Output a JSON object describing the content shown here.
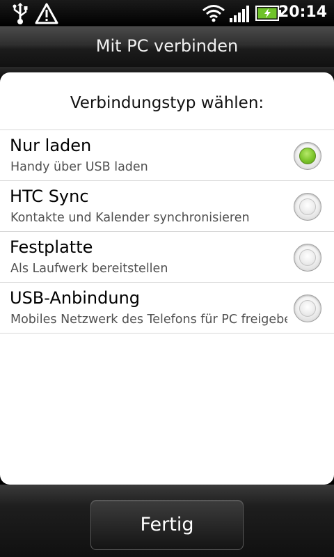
{
  "status_bar": {
    "time": "20:14",
    "icons": [
      "usb-icon",
      "warning-icon",
      "wifi-icon",
      "signal-icon",
      "battery-charging-icon"
    ]
  },
  "title": "Mit PC verbinden",
  "dialog": {
    "heading": "Verbindungstyp wählen:",
    "options": [
      {
        "title": "Nur laden",
        "subtitle": "Handy über USB laden",
        "selected": true
      },
      {
        "title": "HTC Sync",
        "subtitle": "Kontakte und Kalender synchronisieren",
        "selected": false
      },
      {
        "title": "Festplatte",
        "subtitle": "Als Laufwerk bereitstellen",
        "selected": false
      },
      {
        "title": "USB-Anbindung",
        "subtitle": "Mobiles Netzwerk des Telefons für PC freigeben",
        "selected": false
      }
    ]
  },
  "done_button": "Fertig",
  "colors": {
    "radio_selected": "#7cc52b",
    "panel": "#ffffff",
    "background": "#000000"
  }
}
